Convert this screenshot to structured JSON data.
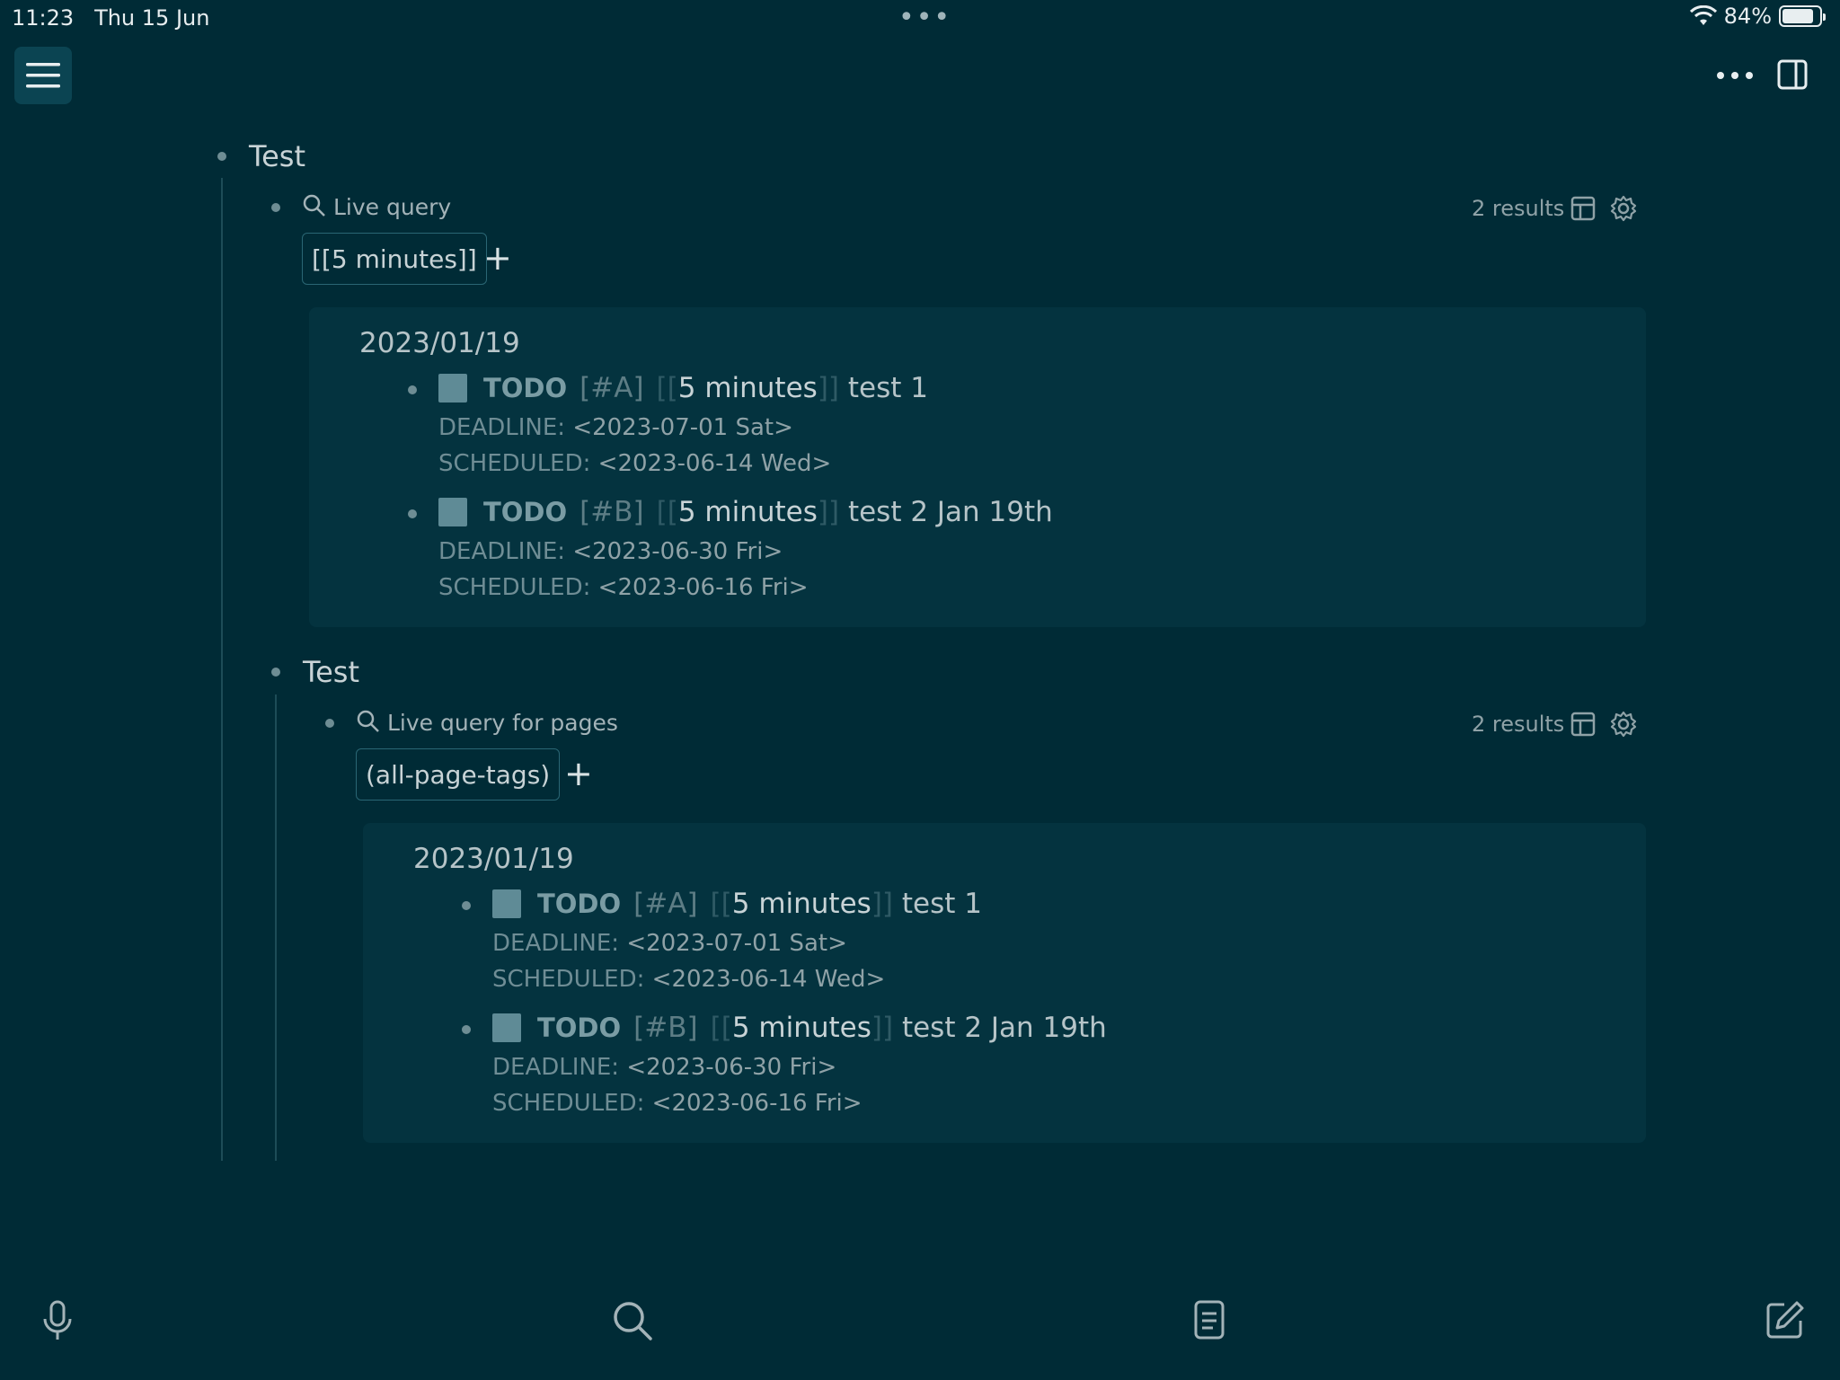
{
  "status": {
    "time": "11:23",
    "date": "Thu 15 Jun",
    "battery": "84%",
    "battery_level": 0.84
  },
  "colors": {
    "background": "#002b36",
    "panel": "#04333f",
    "checkbox": "#5f8b96"
  },
  "blocks": {
    "root_title": "Test",
    "query1": {
      "label": "Live query",
      "results": "2 results",
      "chip": "[[5 minutes]]",
      "group": "2023/01/19",
      "items": [
        {
          "keyword": "TODO",
          "priority": "[#A]",
          "open": "[[",
          "ref": "5 minutes",
          "close": "]]",
          "text": "test 1",
          "deadline_label": "DEADLINE:",
          "deadline": "<2023-07-01 Sat>",
          "scheduled_label": "SCHEDULED:",
          "scheduled": "<2023-06-14 Wed>"
        },
        {
          "keyword": "TODO",
          "priority": "[#B]",
          "open": "[[",
          "ref": "5 minutes",
          "close": "]]",
          "text": "test 2 Jan 19th",
          "deadline_label": "DEADLINE:",
          "deadline": "<2023-06-30 Fri>",
          "scheduled_label": "SCHEDULED:",
          "scheduled": "<2023-06-16 Fri>"
        }
      ]
    },
    "child_title": "Test",
    "query2": {
      "label": "Live query for pages",
      "results": "2 results",
      "chip": "(all-page-tags)",
      "group": "2023/01/19",
      "items": [
        {
          "keyword": "TODO",
          "priority": "[#A]",
          "open": "[[",
          "ref": "5 minutes",
          "close": "]]",
          "text": "test 1",
          "deadline_label": "DEADLINE:",
          "deadline": "<2023-07-01 Sat>",
          "scheduled_label": "SCHEDULED:",
          "scheduled": "<2023-06-14 Wed>"
        },
        {
          "keyword": "TODO",
          "priority": "[#B]",
          "open": "[[",
          "ref": "5 minutes",
          "close": "]]",
          "text": "test 2 Jan 19th",
          "deadline_label": "DEADLINE:",
          "deadline": "<2023-06-30 Fri>",
          "scheduled_label": "SCHEDULED:",
          "scheduled": "<2023-06-16 Fri>"
        }
      ]
    }
  },
  "icons": {
    "menu": "hamburger-icon",
    "more": "more-horizontal-icon",
    "sidebar": "sidebar-toggle-icon",
    "search": "search-icon",
    "table": "table-icon",
    "settings": "gear-icon",
    "mic": "microphone-icon",
    "page": "page-icon",
    "edit": "edit-icon"
  }
}
